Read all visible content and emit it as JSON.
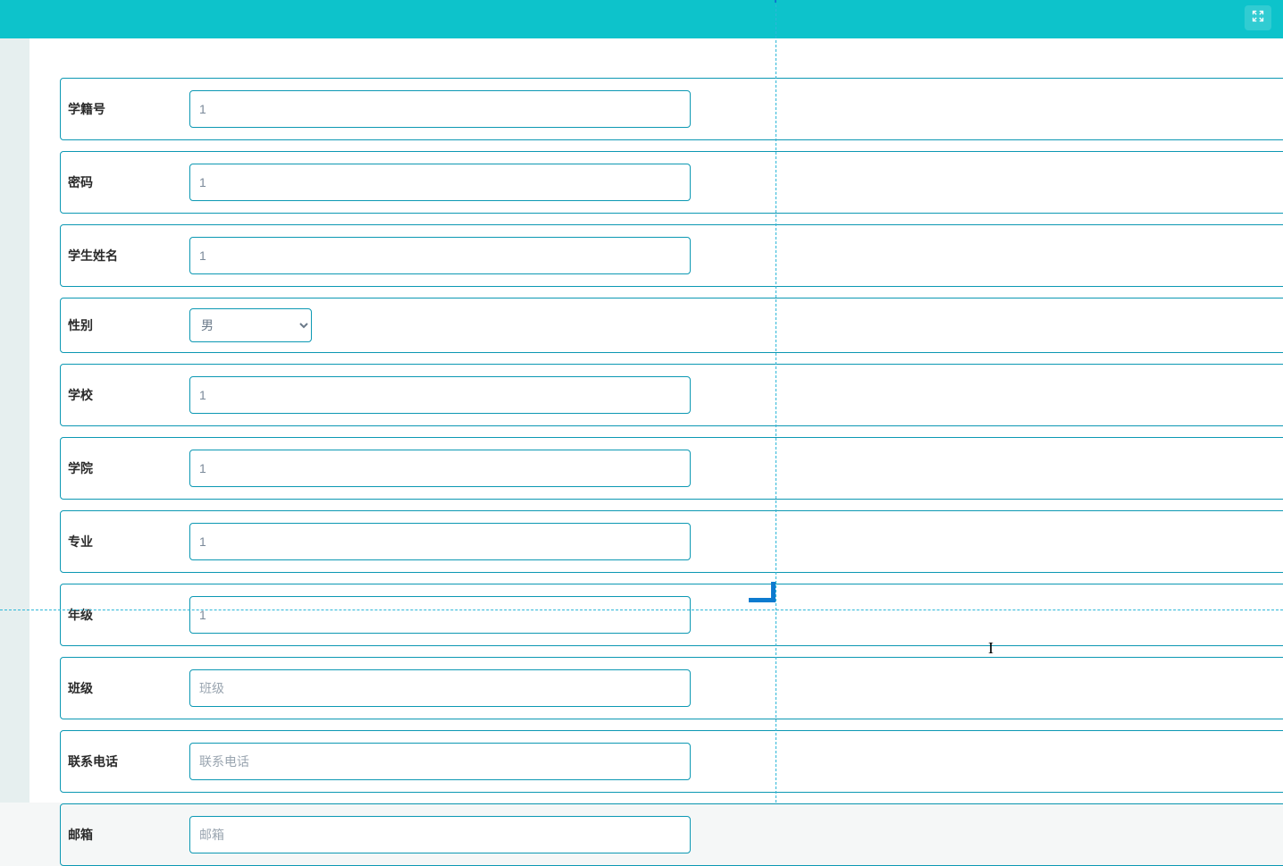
{
  "form": {
    "fields": [
      {
        "label": "学籍号",
        "value": "1",
        "type": "text",
        "name": "student-id",
        "placeholder": ""
      },
      {
        "label": "密码",
        "value": "1",
        "type": "text",
        "name": "password",
        "placeholder": ""
      },
      {
        "label": "学生姓名",
        "value": "1",
        "type": "text",
        "name": "student-name",
        "placeholder": ""
      },
      {
        "label": "性别",
        "value": "男",
        "type": "select",
        "name": "gender",
        "placeholder": ""
      },
      {
        "label": "学校",
        "value": "1",
        "type": "text",
        "name": "school",
        "placeholder": ""
      },
      {
        "label": "学院",
        "value": "1",
        "type": "text",
        "name": "college",
        "placeholder": ""
      },
      {
        "label": "专业",
        "value": "1",
        "type": "text",
        "name": "major",
        "placeholder": ""
      },
      {
        "label": "年级",
        "value": "1",
        "type": "text",
        "name": "grade",
        "placeholder": ""
      },
      {
        "label": "班级",
        "value": "",
        "type": "text",
        "name": "class",
        "placeholder": "班级"
      },
      {
        "label": "联系电话",
        "value": "",
        "type": "text",
        "name": "phone",
        "placeholder": "联系电话"
      },
      {
        "label": "邮箱",
        "value": "",
        "type": "text",
        "name": "email",
        "placeholder": "邮箱"
      }
    ]
  },
  "gender_options": [
    "男"
  ],
  "cursor_glyph": "I"
}
